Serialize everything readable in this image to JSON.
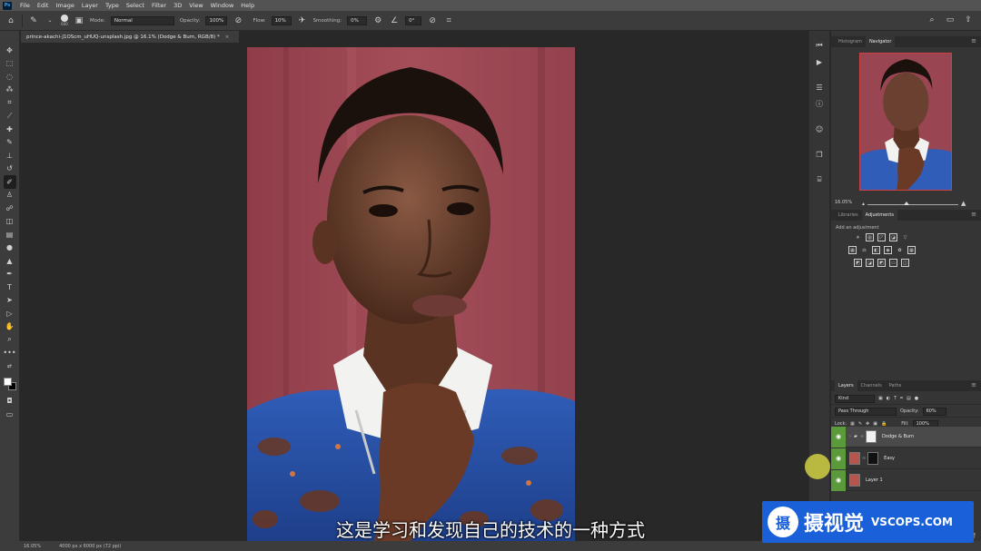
{
  "app": {
    "logo": "Ps"
  },
  "menu": [
    "File",
    "Edit",
    "Image",
    "Layer",
    "Type",
    "Select",
    "Filter",
    "3D",
    "View",
    "Window",
    "Help"
  ],
  "options_bar": {
    "brush_size": "600",
    "mode_label": "Mode:",
    "mode_value": "Normal",
    "opacity_label": "Opacity:",
    "opacity_value": "100%",
    "flow_label": "Flow:",
    "flow_value": "10%",
    "smoothing_label": "Smoothing:",
    "smoothing_value": "0%",
    "angle_value": "0°"
  },
  "document_tab": {
    "title": "prince-akachi-J1OScm_uHUQ-unsplash.jpg @ 16.1% (Dodge & Burn, RGB/8) *",
    "close": "×"
  },
  "status_bar": {
    "zoom": "16.05%",
    "doc_info": "4000 px x 6000 px (72 ppi)"
  },
  "navigator": {
    "tabs": [
      "Histogram",
      "Navigator"
    ],
    "active_tab": "Navigator",
    "zoom_value": "16.05%"
  },
  "adjustments": {
    "tabs": [
      "Libraries",
      "Adjustments"
    ],
    "active_tab": "Adjustments",
    "title": "Add an adjustment"
  },
  "layers": {
    "tabs": [
      "Layers",
      "Channels",
      "Paths"
    ],
    "active_tab": "Layers",
    "filter_kind": "Kind",
    "blend_mode": "Pass Through",
    "opacity_label": "Opacity:",
    "opacity_value": "60%",
    "lock_label": "Lock:",
    "fill_label": "Fill:",
    "fill_value": "100%",
    "items": [
      {
        "name": "Dodge & Burn",
        "type": "group",
        "selected": true
      },
      {
        "name": "Easy",
        "type": "layer",
        "selected": false
      },
      {
        "name": "Layer 1",
        "type": "layer",
        "selected": false
      }
    ]
  },
  "subtitle": "这是学习和发现自己的技术的一种方式",
  "watermark": {
    "logo_char": "摄",
    "cn": "摄视觉",
    "en": "VSCOPS.COM"
  },
  "colors": {
    "ui_dark": "#282828",
    "ui_panel": "#353535",
    "accent_green": "#5b9a3b",
    "watermark_blue": "#1a60d8"
  },
  "icons": {
    "home": "home-icon",
    "brush": "brush-icon",
    "eye": "eye-icon"
  }
}
